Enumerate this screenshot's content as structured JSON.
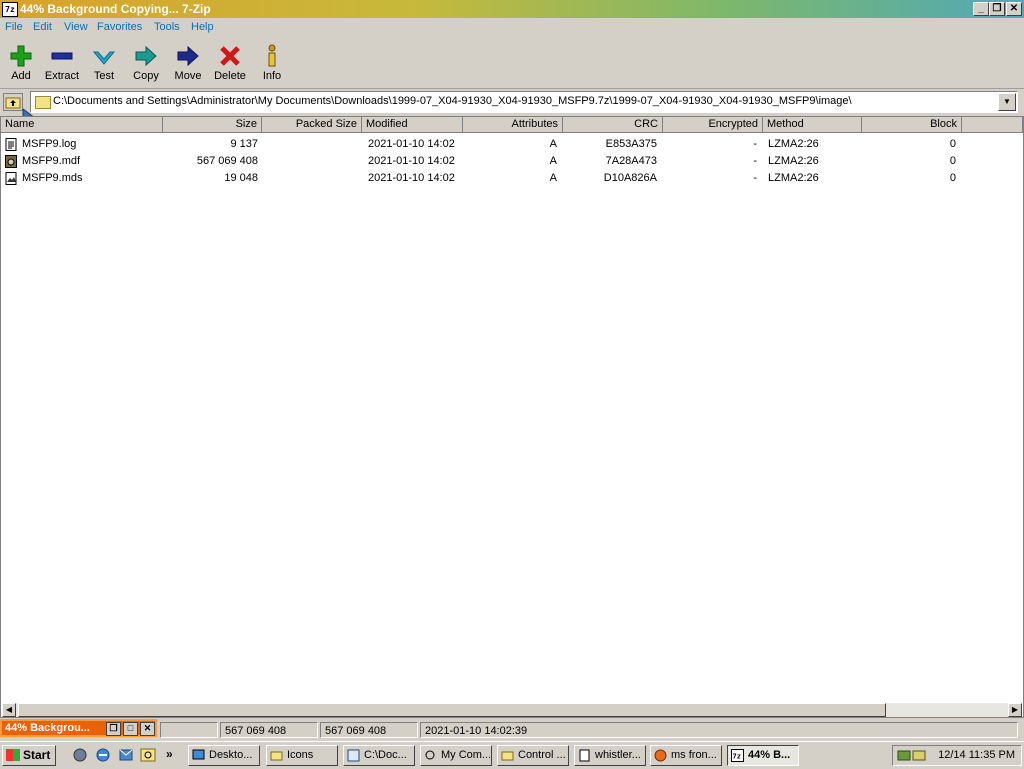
{
  "window": {
    "title": "44% Background Copying... 7-Zip",
    "app_icon": "7z",
    "buttons": [
      "minimize",
      "restore",
      "close"
    ]
  },
  "menu": [
    "File",
    "Edit",
    "View",
    "Favorites",
    "Tools",
    "Help"
  ],
  "toolbar": [
    {
      "label": "Add",
      "icon": "plus-icon",
      "color": "#1aa31a"
    },
    {
      "label": "Extract",
      "icon": "minus-icon",
      "color": "#1f2fa0"
    },
    {
      "label": "Test",
      "icon": "check-icon",
      "color": "#23a8c9"
    },
    {
      "label": "Copy",
      "icon": "arrow-right-icon",
      "color": "#1c9a8e"
    },
    {
      "label": "Move",
      "icon": "arrow-right-icon",
      "color": "#1f2a8a"
    },
    {
      "label": "Delete",
      "icon": "x-icon",
      "color": "#d01818"
    },
    {
      "label": "Info",
      "icon": "info-icon",
      "color": "#c9a020"
    }
  ],
  "address": {
    "path": "C:\\Documents and Settings\\Administrator\\My Documents\\Downloads\\1999-07_X04-91930_X04-91930_MSFP9.7z\\1999-07_X04-91930_X04-91930_MSFP9\\image\\"
  },
  "columns": [
    "Name",
    "Size",
    "Packed Size",
    "Modified",
    "Attributes",
    "CRC",
    "Encrypted",
    "Method",
    "Block"
  ],
  "files": [
    {
      "name": "MSFP9.log",
      "size": "9 137",
      "packed": "",
      "modified": "2021-01-10 14:02",
      "attributes": "A",
      "crc": "E853A375",
      "encrypted": "-",
      "method": "LZMA2:26",
      "block": "0",
      "icon": "text-file-icon"
    },
    {
      "name": "MSFP9.mdf",
      "size": "567 069 408",
      "packed": "",
      "modified": "2021-01-10 14:02",
      "attributes": "A",
      "crc": "7A28A473",
      "encrypted": "-",
      "method": "LZMA2:26",
      "block": "0",
      "icon": "disc-image-icon"
    },
    {
      "name": "MSFP9.mds",
      "size": "19 048",
      "packed": "",
      "modified": "2021-01-10 14:02",
      "attributes": "A",
      "crc": "D10A826A",
      "encrypted": "-",
      "method": "LZMA2:26",
      "block": "0",
      "icon": "image-file-icon"
    }
  ],
  "status": {
    "size": "567 069 408",
    "packed": "567 069 408",
    "modified": "2021-01-10 14:02:39"
  },
  "minimized_window": {
    "title": "44% Backgrou..."
  },
  "taskbar": {
    "start": "Start",
    "tasks": [
      "Deskto...",
      "Icons",
      "C:\\Doc...",
      "My Com...",
      "Control ...",
      "whistler...",
      "ms fron...",
      "44% B..."
    ],
    "clock": "12/14 11:35 PM",
    "overflow": "»"
  }
}
